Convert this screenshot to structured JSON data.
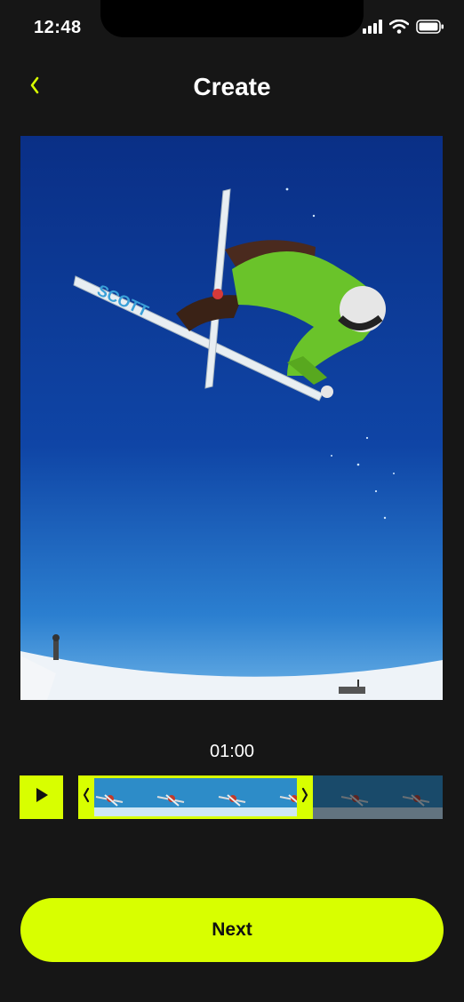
{
  "status_bar": {
    "time": "12:48",
    "icons": [
      "signal-icon",
      "wifi-icon",
      "battery-icon"
    ]
  },
  "header": {
    "title": "Create",
    "back_icon": "chevron-left-icon"
  },
  "preview": {
    "subject": "freestyle skier mid-air against blue sky"
  },
  "timeline": {
    "duration": "01:00",
    "play_icon": "play-icon",
    "frame_count": 6,
    "selected_frames": 4
  },
  "footer": {
    "next_label": "Next"
  },
  "colors": {
    "accent": "#d8ff00",
    "background": "#161616",
    "sky": "#0c3a8e"
  }
}
